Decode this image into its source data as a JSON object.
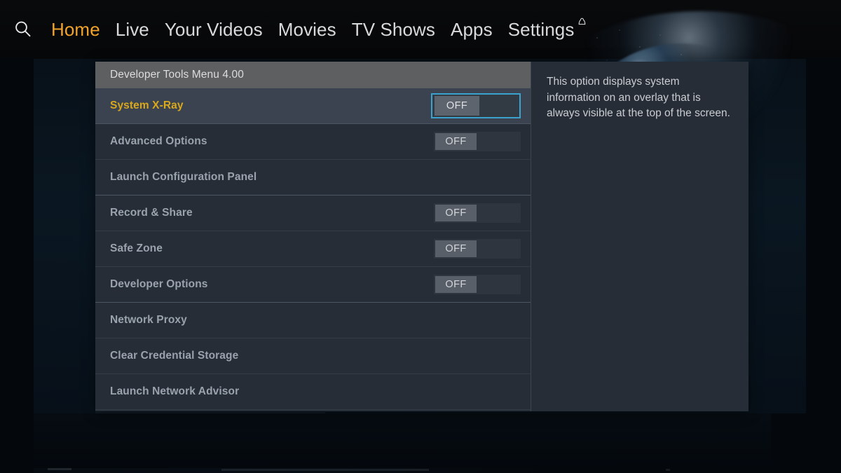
{
  "topnav": {
    "search_icon": "search-icon",
    "items": [
      {
        "label": "Home",
        "active": true
      },
      {
        "label": "Live",
        "active": false
      },
      {
        "label": "Your Videos",
        "active": false
      },
      {
        "label": "Movies",
        "active": false
      },
      {
        "label": "TV Shows",
        "active": false
      },
      {
        "label": "Apps",
        "active": false
      },
      {
        "label": "Settings",
        "active": false
      }
    ],
    "notification_icon": "bell-icon",
    "active_color": "#f1a32a",
    "inactive_color": "#d7d9db"
  },
  "dev_menu": {
    "header_title": "Developer Tools Menu 4.00",
    "focus_border_color": "#3ba2ce",
    "selected_label_color": "#d8a81c",
    "rows": [
      {
        "label": "System X-Ray",
        "has_toggle": true,
        "toggle_value": "OFF",
        "selected": true,
        "group_end": false
      },
      {
        "label": "Advanced Options",
        "has_toggle": true,
        "toggle_value": "OFF",
        "selected": false,
        "group_end": false
      },
      {
        "label": "Launch Configuration Panel",
        "has_toggle": false,
        "toggle_value": "",
        "selected": false,
        "group_end": true
      },
      {
        "label": "Record & Share",
        "has_toggle": true,
        "toggle_value": "OFF",
        "selected": false,
        "group_end": false
      },
      {
        "label": "Safe Zone",
        "has_toggle": true,
        "toggle_value": "OFF",
        "selected": false,
        "group_end": false
      },
      {
        "label": "Developer Options",
        "has_toggle": true,
        "toggle_value": "OFF",
        "selected": false,
        "group_end": true
      },
      {
        "label": "Network Proxy",
        "has_toggle": false,
        "toggle_value": "",
        "selected": false,
        "group_end": false
      },
      {
        "label": "Clear Credential Storage",
        "has_toggle": false,
        "toggle_value": "",
        "selected": false,
        "group_end": false
      },
      {
        "label": "Launch Network Advisor",
        "has_toggle": false,
        "toggle_value": "",
        "selected": false,
        "group_end": false
      }
    ]
  },
  "description": {
    "text": "This option displays system information on an overlay that is always visible at the top of the screen."
  }
}
